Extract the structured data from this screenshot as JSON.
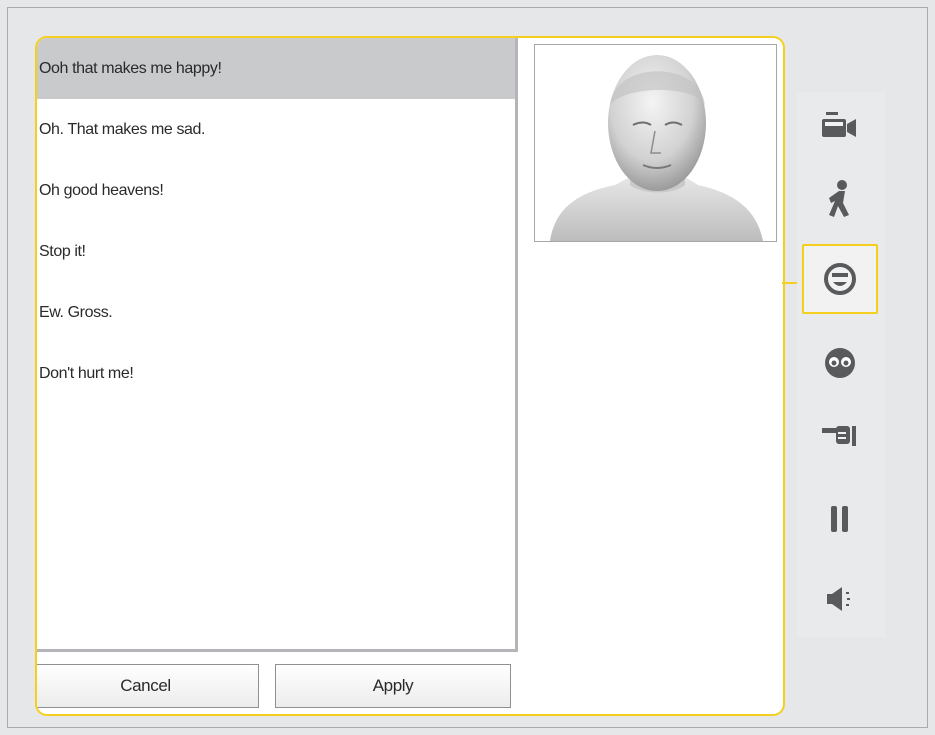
{
  "dialog": {
    "phrases": [
      "Ooh that makes me happy!",
      "Oh. That makes me sad.",
      "Oh good heavens!",
      "Stop it!",
      "Ew. Gross.",
      "Don't hurt me!"
    ],
    "selected_index": 0,
    "cancel_label": "Cancel",
    "apply_label": "Apply"
  },
  "toolbar": {
    "items": [
      {
        "icon": "camera-icon"
      },
      {
        "icon": "walk-icon"
      },
      {
        "icon": "expression-icon",
        "selected": true
      },
      {
        "icon": "eyes-icon"
      },
      {
        "icon": "point-hand-icon"
      },
      {
        "icon": "pause-icon"
      },
      {
        "icon": "speaker-icon"
      }
    ]
  },
  "colors": {
    "accent": "#f5cf1e",
    "icon": "#595a5c",
    "selected_row": "#c9cacc",
    "background": "#e6e7e9"
  }
}
